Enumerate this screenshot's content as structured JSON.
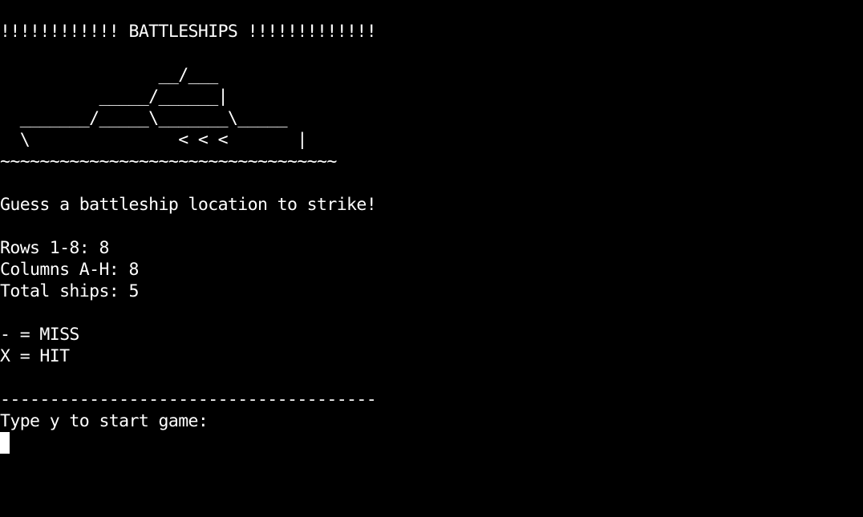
{
  "terminal": {
    "title_banner": "!!!!!!!!!!!! BATTLESHIPS !!!!!!!!!!!!!",
    "ship_art": [
      "",
      "                __/___",
      "          _____/______|",
      "  _______/_____\\_______\\_____",
      "  \\               < < <       |",
      "~~~~~~~~~~~~~~~~~~~~~~~~~~~~~~~~~~"
    ],
    "intro": "Guess a battleship location to strike!",
    "rows_info": "Rows 1-8: 8",
    "columns_info": "Columns A-H: 8",
    "ships_info": "Total ships: 5",
    "legend_miss": "- = MISS",
    "legend_hit": "X = HIT",
    "divider": "--------------------------------------",
    "start_prompt": "Type y to start game:",
    "input_value": ""
  }
}
